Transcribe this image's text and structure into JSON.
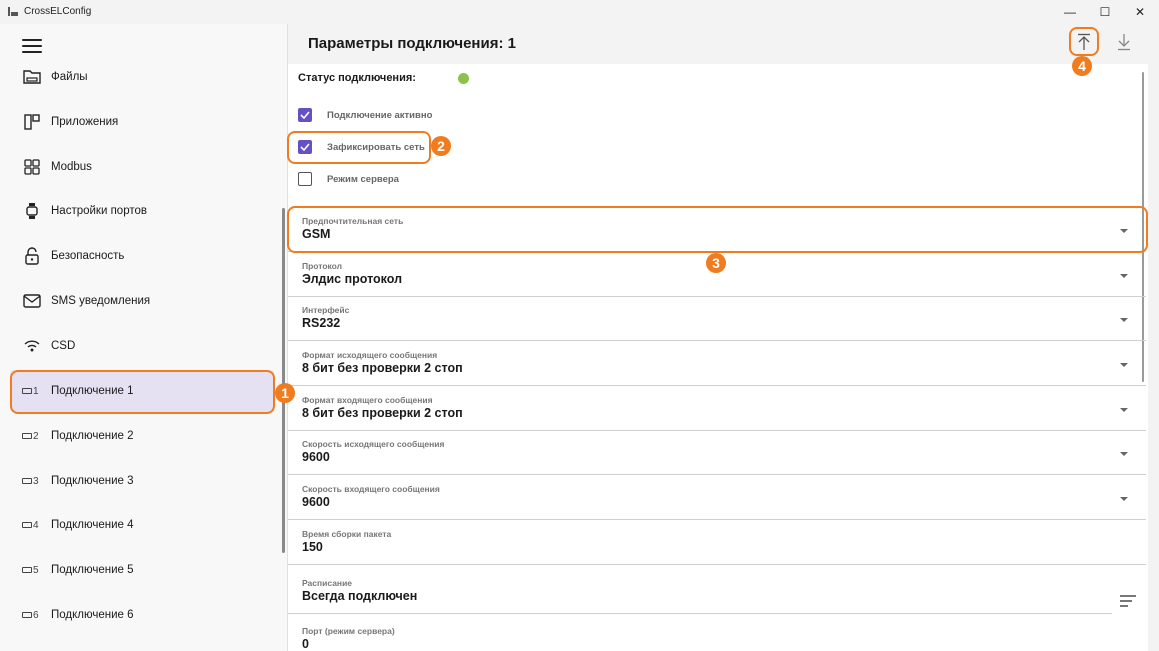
{
  "window": {
    "title": "CrossELConfig",
    "min_glyph": "—",
    "max_glyph": "☐",
    "close_glyph": "✕"
  },
  "sidebar": {
    "items": [
      {
        "label": "Файлы",
        "icon": "folder-icon"
      },
      {
        "label": "Приложения",
        "icon": "apps-icon"
      },
      {
        "label": "Modbus",
        "icon": "grid-icon"
      },
      {
        "label": "Настройки портов",
        "icon": "watch-port-icon"
      },
      {
        "label": "Безопасность",
        "icon": "unlock-icon"
      },
      {
        "label": "SMS уведомления",
        "icon": "mail-icon"
      },
      {
        "label": "CSD",
        "icon": "wireless-icon"
      },
      {
        "label": "Подключение 1",
        "num": "1",
        "icon": "connection-icon"
      },
      {
        "label": "Подключение 2",
        "num": "2",
        "icon": "connection-icon"
      },
      {
        "label": "Подключение 3",
        "num": "3",
        "icon": "connection-icon"
      },
      {
        "label": "Подключение 4",
        "num": "4",
        "icon": "connection-icon"
      },
      {
        "label": "Подключение 5",
        "num": "5",
        "icon": "connection-icon"
      },
      {
        "label": "Подключение 6",
        "num": "6",
        "icon": "connection-icon"
      }
    ],
    "selected_index": 7
  },
  "header": {
    "title": "Параметры подключения: 1",
    "upload_icon": "upload-icon",
    "download_icon": "download-icon"
  },
  "status": {
    "label": "Статус подключения:",
    "color": "#8bc34a"
  },
  "checkboxes": [
    {
      "label": "Подключение активно",
      "checked": true
    },
    {
      "label": "Зафиксировать сеть",
      "checked": true
    },
    {
      "label": "Режим сервера",
      "checked": false
    }
  ],
  "fields": [
    {
      "label": "Предпочтительная сеть",
      "value": "GSM",
      "kind": "dropdown"
    },
    {
      "label": "Протокол",
      "value": "Элдис протокол",
      "kind": "dropdown"
    },
    {
      "label": "Интерфейс",
      "value": "RS232",
      "kind": "dropdown"
    },
    {
      "label": "Формат исходящего сообщения",
      "value": "8 бит без проверки 2 стоп",
      "kind": "dropdown"
    },
    {
      "label": "Формат входящего сообщения",
      "value": "8 бит без проверки 2 стоп",
      "kind": "dropdown"
    },
    {
      "label": "Скорость исходящего сообщения",
      "value": "9600",
      "kind": "dropdown"
    },
    {
      "label": "Скорость входящего сообщения",
      "value": "9600",
      "kind": "dropdown"
    },
    {
      "label": "Время сборки пакета",
      "value": "150",
      "kind": "text"
    },
    {
      "label": "Расписание",
      "value": "Всегда подключен",
      "kind": "schedule"
    },
    {
      "label": "Порт (режим сервера)",
      "value": "0",
      "kind": "text"
    }
  ],
  "annotations": {
    "badge1": "1",
    "badge2": "2",
    "badge3": "3",
    "badge4": "4",
    "color": "#f07c1f"
  },
  "accent": "#6750c4"
}
